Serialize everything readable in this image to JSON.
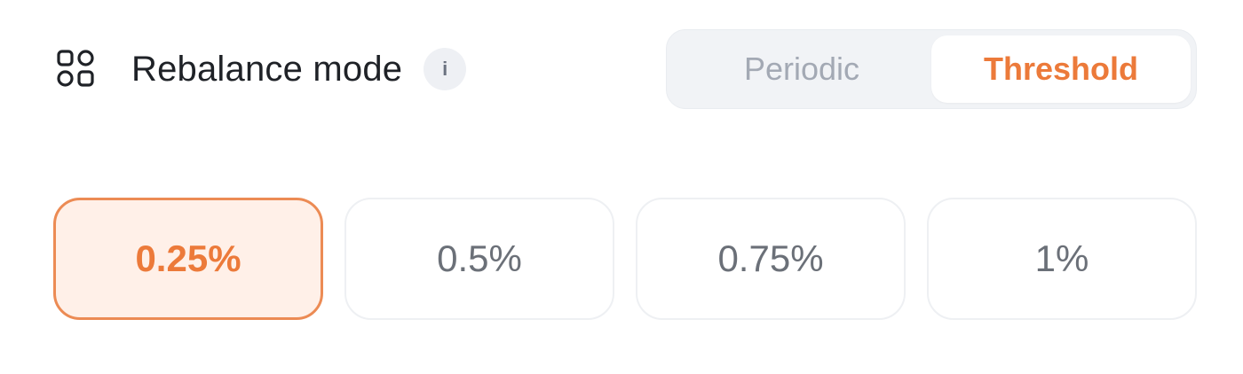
{
  "header": {
    "icon": "apps-grid-icon",
    "title": "Rebalance mode",
    "info_icon": "info-icon",
    "info_label": "i"
  },
  "mode_toggle": {
    "options": [
      "Periodic",
      "Threshold"
    ],
    "selected": "Threshold"
  },
  "threshold_options": {
    "values": [
      "0.25%",
      "0.5%",
      "0.75%",
      "1%"
    ],
    "selected": "0.25%"
  },
  "colors": {
    "accent": "#ec7a3a",
    "accent_bg": "#fff0e8",
    "text_primary": "#1f2227",
    "text_muted": "#6b7078"
  }
}
